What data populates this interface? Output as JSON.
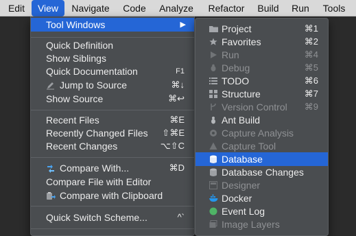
{
  "menubar": {
    "items": [
      {
        "label": "Edit"
      },
      {
        "label": "View"
      },
      {
        "label": "Navigate"
      },
      {
        "label": "Code"
      },
      {
        "label": "Analyze"
      },
      {
        "label": "Refactor"
      },
      {
        "label": "Build"
      },
      {
        "label": "Run"
      },
      {
        "label": "Tools"
      }
    ]
  },
  "view_menu": {
    "tool_windows": {
      "label": "Tool Windows",
      "arrow": "▶"
    },
    "quick_definition": {
      "label": "Quick Definition"
    },
    "show_siblings": {
      "label": "Show Siblings"
    },
    "quick_documentation": {
      "label": "Quick Documentation",
      "shortcut": "F1"
    },
    "jump_to_source": {
      "label": "Jump to Source",
      "shortcut": "⌘↓",
      "icon": "pencil-icon"
    },
    "show_source": {
      "label": "Show Source",
      "shortcut": "⌘↩"
    },
    "recent_files": {
      "label": "Recent Files",
      "shortcut": "⌘E"
    },
    "recently_changed_files": {
      "label": "Recently Changed Files",
      "shortcut": "⇧⌘E"
    },
    "recent_changes": {
      "label": "Recent Changes",
      "shortcut": "⌥⇧C"
    },
    "compare_with": {
      "label": "Compare With...",
      "shortcut": "⌘D",
      "icon": "compare-icon"
    },
    "compare_file_with_editor": {
      "label": "Compare File with Editor"
    },
    "compare_with_clipboard": {
      "label": "Compare with Clipboard",
      "icon": "clipboard-compare-icon"
    },
    "quick_switch_scheme": {
      "label": "Quick Switch Scheme...",
      "shortcut": "^`"
    }
  },
  "tool_windows_menu": {
    "items": [
      {
        "label": "Project",
        "shortcut": "⌘1",
        "icon": "folder-icon",
        "enabled": true
      },
      {
        "label": "Favorites",
        "shortcut": "⌘2",
        "icon": "star-icon",
        "enabled": true
      },
      {
        "label": "Run",
        "shortcut": "⌘4",
        "icon": "play-icon",
        "enabled": false
      },
      {
        "label": "Debug",
        "shortcut": "⌘5",
        "icon": "bug-icon",
        "enabled": false
      },
      {
        "label": "TODO",
        "shortcut": "⌘6",
        "icon": "todo-list-icon",
        "enabled": true
      },
      {
        "label": "Structure",
        "shortcut": "⌘7",
        "icon": "structure-icon",
        "enabled": true
      },
      {
        "label": "Version Control",
        "shortcut": "⌘9",
        "icon": "branch-icon",
        "enabled": false
      },
      {
        "label": "Ant Build",
        "shortcut": "",
        "icon": "ant-icon",
        "enabled": true
      },
      {
        "label": "Capture Analysis",
        "shortcut": "",
        "icon": "capture-icon",
        "enabled": false
      },
      {
        "label": "Capture Tool",
        "shortcut": "",
        "icon": "warning-icon",
        "enabled": false
      },
      {
        "label": "Database",
        "shortcut": "",
        "icon": "database-icon",
        "enabled": true,
        "highlighted": true
      },
      {
        "label": "Database Changes",
        "shortcut": "",
        "icon": "database-changes-icon",
        "enabled": true
      },
      {
        "label": "Designer",
        "shortcut": "",
        "icon": "designer-icon",
        "enabled": false
      },
      {
        "label": "Docker",
        "shortcut": "",
        "icon": "docker-icon",
        "enabled": true
      },
      {
        "label": "Event Log",
        "shortcut": "",
        "icon": "event-log-icon",
        "enabled": true
      },
      {
        "label": "Image Layers",
        "shortcut": "",
        "icon": "image-layers-icon",
        "enabled": false
      }
    ]
  },
  "colors": {
    "highlight": "#2566d6",
    "menu_bg": "#4a4d50",
    "menubar_bg": "#d9d9d9"
  }
}
